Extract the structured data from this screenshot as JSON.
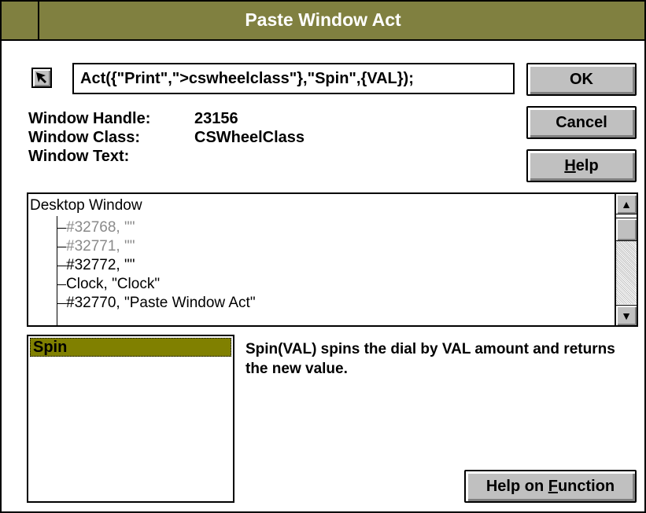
{
  "window": {
    "title": "Paste Window Act"
  },
  "toolbar": {
    "pointer_icon": "arrow-pointer-icon"
  },
  "act_field": {
    "value": "Act({\"Print\",\">cswheelclass\"},\"Spin\",{VAL});"
  },
  "buttons": {
    "ok": "OK",
    "cancel": "Cancel",
    "help_underlined": "H",
    "help_rest": "elp",
    "help_fn_prefix": "Help on ",
    "help_fn_underlined": "F",
    "help_fn_rest": "unction"
  },
  "info": {
    "handle_label": "Window Handle:",
    "handle_value": "23156",
    "class_label": "Window Class:",
    "class_value": "CSWheelClass",
    "text_label": "Window Text:",
    "text_value": ""
  },
  "tree": {
    "root": "Desktop Window",
    "items": [
      {
        "label": "#32768, \"\"",
        "dim": true
      },
      {
        "label": "#32771, \"\"",
        "dim": true
      },
      {
        "label": "#32772, \"\"",
        "dim": false
      },
      {
        "label": "Clock, \"Clock\"",
        "dim": false
      },
      {
        "label": "#32770, \"Paste Window Act\"",
        "dim": false
      }
    ]
  },
  "functions": {
    "items": [
      "Spin"
    ],
    "selected": "Spin",
    "description": "Spin(VAL) spins the dial by VAL amount and returns the new value."
  },
  "colors": {
    "titlebar": "#808040",
    "selection": "#808000",
    "button_face": "#c0c0c0"
  }
}
